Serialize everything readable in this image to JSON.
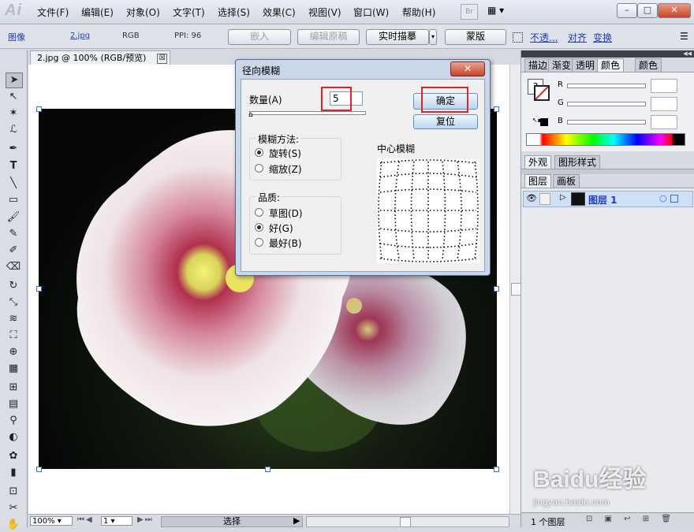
{
  "app": {
    "logo": "Ai"
  },
  "menubar": {
    "items": [
      "文件(F)",
      "编辑(E)",
      "对象(O)",
      "文字(T)",
      "选择(S)",
      "效果(C)",
      "视图(V)",
      "窗口(W)",
      "帮助(H)"
    ],
    "bridge_label": "Br"
  },
  "controlbar": {
    "image_label": "图像",
    "filename_link": "2.jpg",
    "color_mode": "RGB",
    "ppi": "PPI: 96",
    "embed_label": "嵌入",
    "edit_original_label": "编辑原稿",
    "live_trace_label": "实时描摹",
    "mask_label": "蒙版",
    "opacity_link": "不透...",
    "align_link": "对齐",
    "transform_link": "变换"
  },
  "document": {
    "tab_title": "2.jpg @ 100% (RGB/预览)",
    "close_glyph": "☒"
  },
  "statusbar": {
    "zoom": "100%",
    "page": "1",
    "tool_name": "选择"
  },
  "panels": {
    "tabs_top": [
      "描边",
      "渐变",
      "透明",
      "颜色",
      "颜色"
    ],
    "r_label": "R",
    "g_label": "G",
    "b_label": "B",
    "tabs_mid": [
      "外观",
      "图形样式"
    ],
    "tabs_layers": [
      "图层",
      "画板"
    ],
    "layer_name": "图层 1",
    "layer_count": "1 个图层"
  },
  "dialog": {
    "title": "径向模糊",
    "amount_label": "数量(A)",
    "amount_value": "5",
    "ok_label": "确定",
    "reset_label": "复位",
    "method_label": "模糊方法:",
    "method_spin": "旋转(S)",
    "method_zoom": "缩放(Z)",
    "quality_label": "品质:",
    "quality_draft": "草图(D)",
    "quality_good": "好(G)",
    "quality_best": "最好(B)",
    "center_label": "中心模糊",
    "close_glyph": "✕"
  },
  "watermark": {
    "brand": "Baidu经验",
    "url": "jingyan.baidu.com"
  },
  "colors": {
    "accent": "#1d3bbd",
    "highlight": "#e02424",
    "selection": "#3a6fd8"
  }
}
